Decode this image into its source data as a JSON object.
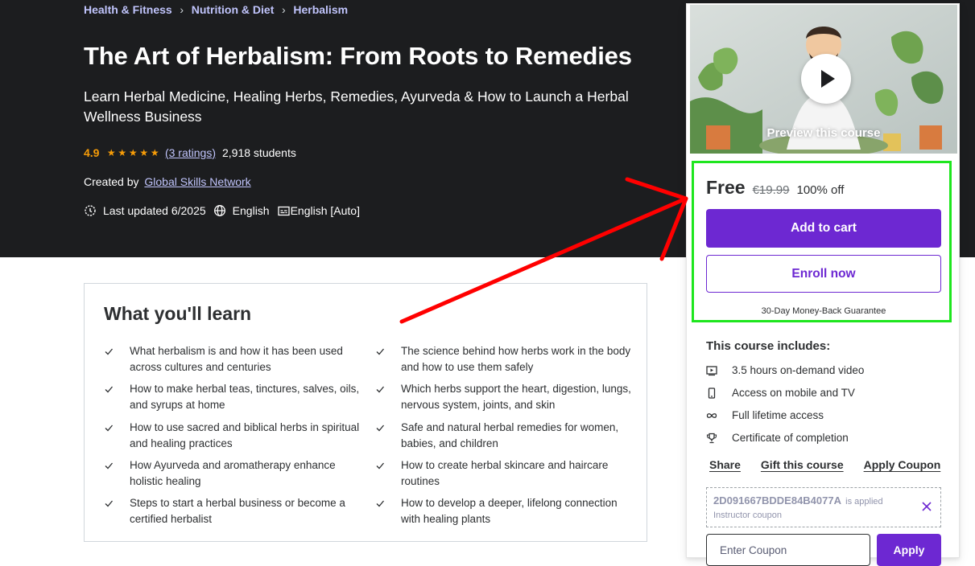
{
  "breadcrumb": [
    "Health & Fitness",
    "Nutrition & Diet",
    "Herbalism"
  ],
  "course": {
    "title": "The Art of Herbalism: From Roots to Remedies",
    "subtitle": "Learn Herbal Medicine, Healing Herbs, Remedies, Ayurveda & How to Launch a Herbal Wellness Business",
    "rating": "4.9",
    "stars": 5,
    "ratings_link": "(3 ratings)",
    "students": "2,918 students",
    "created_by_label": "Created by",
    "instructor": "Global Skills Network",
    "last_updated": "Last updated 6/2025",
    "language": "English",
    "captions": "English [Auto]"
  },
  "learn": {
    "title": "What you'll learn",
    "items": [
      "What herbalism is and how it has been used across cultures and centuries",
      "The science behind how herbs work in the body and how to use them safely",
      "How to make herbal teas, tinctures, salves, oils, and syrups at home",
      "Which herbs support the heart, digestion, lungs, nervous system, joints, and skin",
      "How to use sacred and biblical herbs in spiritual and healing practices",
      "Safe and natural herbal remedies for women, babies, and children",
      "How Ayurveda and aromatherapy enhance holistic healing",
      "How to create herbal skincare and haircare routines",
      "Steps to start a herbal business or become a certified herbalist",
      "How to develop a deeper, lifelong connection with healing plants"
    ]
  },
  "sidebar": {
    "preview_label": "Preview this course",
    "price": "Free",
    "original_price": "€19.99",
    "discount": "100% off",
    "add_to_cart": "Add to cart",
    "enroll_now": "Enroll now",
    "guarantee": "30-Day Money-Back Guarantee",
    "includes_title": "This course includes:",
    "includes": [
      {
        "icon": "video-icon",
        "text": "3.5 hours on-demand video"
      },
      {
        "icon": "mobile-icon",
        "text": "Access on mobile and TV"
      },
      {
        "icon": "infinity-icon",
        "text": "Full lifetime access"
      },
      {
        "icon": "trophy-icon",
        "text": "Certificate of completion"
      }
    ],
    "links": [
      "Share",
      "Gift this course",
      "Apply Coupon"
    ],
    "coupon": {
      "code": "2D091667BDDE84B4077A",
      "applied_text": "is applied",
      "type": "Instructor coupon",
      "input_placeholder": "Enter Coupon",
      "apply_label": "Apply"
    }
  },
  "colors": {
    "hero_bg": "#1c1d1f",
    "accent_purple": "#6d28d2",
    "star_orange": "#f69c08",
    "link_lavender": "#c0c4fc",
    "annotation_red": "#ff0000",
    "annotation_green": "#1ee61e"
  }
}
